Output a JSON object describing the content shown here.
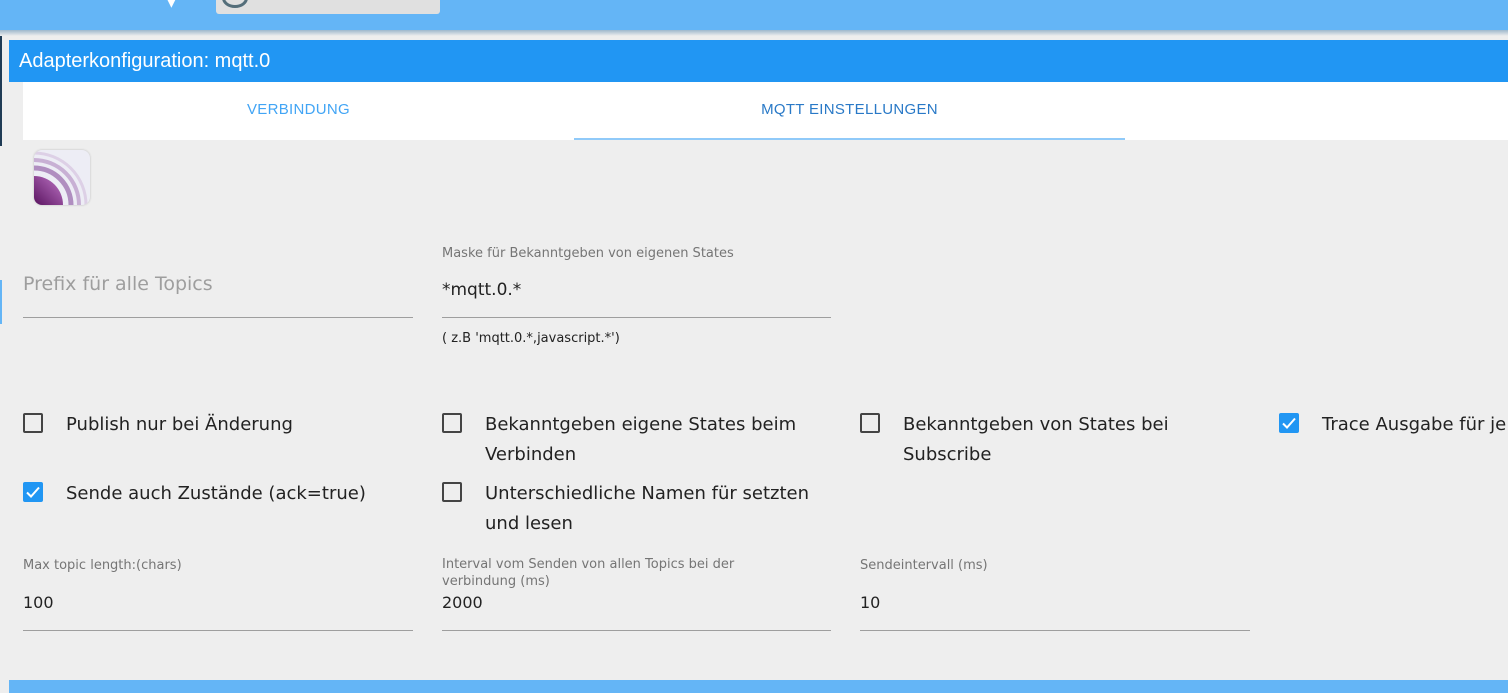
{
  "dialog": {
    "title": "Adapterkonfiguration: mqtt.0"
  },
  "tabs": [
    {
      "label": "VERBINDUNG",
      "active": false
    },
    {
      "label": "MQTT EINSTELLUNGEN",
      "active": true
    }
  ],
  "fields": {
    "prefix": {
      "placeholder": "Prefix für alle Topics",
      "value": ""
    },
    "mask": {
      "label": "Maske für Bekanntgeben von eigenen States",
      "value": "*mqtt.0.*",
      "helper": "( z.B 'mqtt.0.*,javascript.*')"
    },
    "max_topic_length": {
      "label": "Max topic length:(chars)",
      "value": "100"
    },
    "interval_all_topics": {
      "label": "Interval vom Senden von allen Topics bei der verbindung (ms)",
      "value": "2000"
    },
    "send_interval": {
      "label": "Sendeintervall (ms)",
      "value": "10"
    }
  },
  "checkboxes": [
    {
      "label": "Publish nur bei Änderung",
      "checked": false
    },
    {
      "label": "Bekanntgeben eigene States beim Verbinden",
      "checked": false
    },
    {
      "label": "Bekanntgeben von States bei Subscribe",
      "checked": false
    },
    {
      "label": "Trace Ausgabe für je",
      "checked": true
    },
    {
      "label": "Sende auch Zustände (ack=true)",
      "checked": true
    },
    {
      "label": "Unterschiedliche Namen für setzten und lesen",
      "checked": false
    }
  ],
  "colors": {
    "primary": "#2196f3",
    "topbar": "#64b5f6",
    "tab_text": "#42a5f5",
    "background": "#eeeeee"
  },
  "icons": {
    "logo": "mqtt-broadcast-icon",
    "checkbox_check": "checkmark-icon"
  }
}
